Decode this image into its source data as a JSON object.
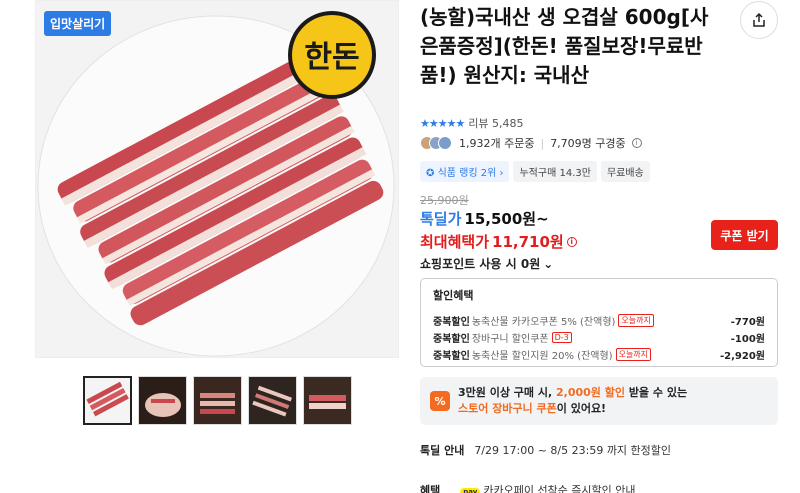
{
  "product": {
    "badge": "입맛살리기",
    "brand_logo_text": "한돈",
    "title": "(농할)국내산 생 오겹살 600g[사은품증정](한돈! 품질보장!무료반품!) 원산지: 국내산"
  },
  "rating": {
    "stars": "★★★★★",
    "review_label": "리뷰 5,485"
  },
  "stats": {
    "orders": "1,932개 주문중",
    "viewers": "7,709명 구경중"
  },
  "chips": [
    "식품 랭킹 2위",
    "누적구매 14.3만",
    "무료배송"
  ],
  "price": {
    "original": "25,900원",
    "deal_label": "톡딜가",
    "deal_price": "15,500원~",
    "max_label": "최대혜택가",
    "max_price": "11,710원",
    "coupon_button": "쿠폰 받기",
    "points": "쇼핑포인트 사용 시 0원"
  },
  "discounts": {
    "title": "할인혜택",
    "items": [
      {
        "type": "중복할인",
        "desc": "농축산물 카카오쿠폰 5% (잔액형)",
        "tag": "오늘까지",
        "amount": "-770원"
      },
      {
        "type": "중복할인",
        "desc": "장바구니 할인쿠폰",
        "tag": "D-3",
        "amount": "-100원"
      },
      {
        "type": "중복할인",
        "desc": "농축산물 할인지원 20% (잔액형)",
        "tag": "오늘까지",
        "amount": "-2,920원"
      }
    ]
  },
  "promo": {
    "icon": "%",
    "line1_a": "3만원 이상 구매 시, ",
    "line1_b": "2,000원 할인",
    "line1_c": " 받을 수 있는",
    "line2_a": "스토어 장바구니 쿠폰",
    "line2_b": "이 있어요!"
  },
  "notice": {
    "label": "톡딜 안내",
    "text": "7/29 17:00 ~ 8/5 23:59 까지 한정할인"
  },
  "benefit": {
    "label": "혜택",
    "pay_badge": "pay",
    "text": "카카오페이 선착순 즉시할인 안내"
  },
  "colors": {
    "accent_blue": "#2d7be5",
    "accent_red": "#e8211b",
    "promo_orange": "#f36b21"
  }
}
